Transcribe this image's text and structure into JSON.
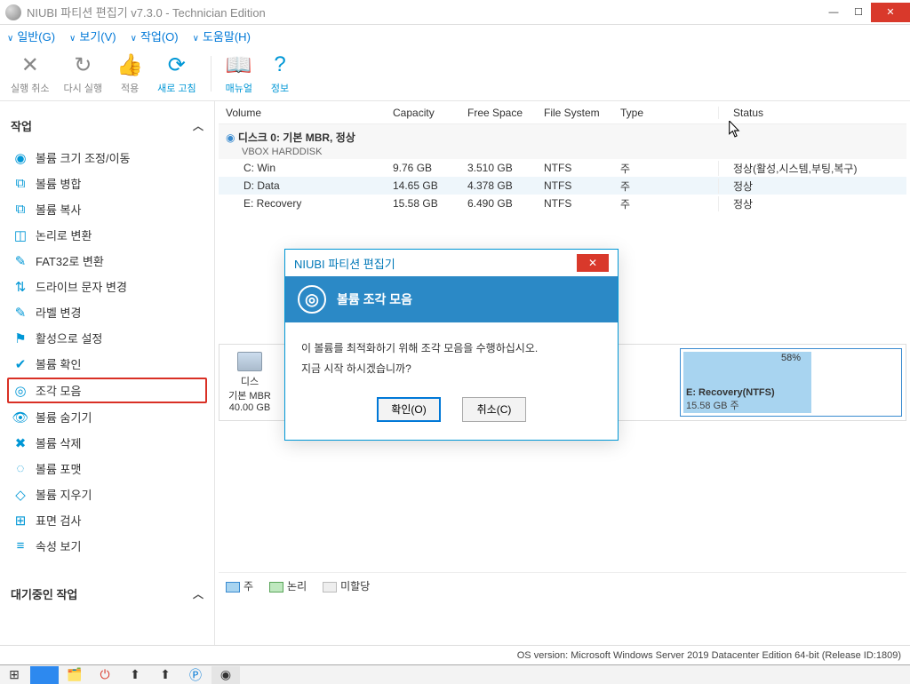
{
  "title": "NIUBI 파티션 편집기 v7.3.0 - Technician Edition",
  "menu": {
    "general": "일반(G)",
    "view": "보기(V)",
    "task": "작업(O)",
    "help": "도움말(H)"
  },
  "toolbar": {
    "undo": "실행 취소",
    "redo": "다시 실행",
    "apply": "적용",
    "refresh": "새로 고침",
    "manual": "매뉴얼",
    "info": "정보"
  },
  "sidebar": {
    "tasks_label": "작업",
    "items": [
      {
        "icon": "◉",
        "label": "볼륨 크기 조정/이동"
      },
      {
        "icon": "⧉",
        "label": "볼륨 병합"
      },
      {
        "icon": "⧉",
        "label": "볼륨 복사"
      },
      {
        "icon": "◫",
        "label": "논리로 변환"
      },
      {
        "icon": "✎",
        "label": "FAT32로 변환"
      },
      {
        "icon": "⇅",
        "label": "드라이브 문자 변경"
      },
      {
        "icon": "✎",
        "label": "라벨 변경"
      },
      {
        "icon": "⚑",
        "label": "활성으로 설정"
      },
      {
        "icon": "✔",
        "label": "볼륨 확인"
      },
      {
        "icon": "◎",
        "label": "조각 모음"
      },
      {
        "icon": "👁",
        "label": "볼륨 숨기기"
      },
      {
        "icon": "✖",
        "label": "볼륨 삭제"
      },
      {
        "icon": "◌",
        "label": "볼륨 포맷"
      },
      {
        "icon": "◇",
        "label": "볼륨 지우기"
      },
      {
        "icon": "⊞",
        "label": "표면 검사"
      },
      {
        "icon": "≡",
        "label": "속성 보기"
      }
    ],
    "pending_label": "대기중인 작업"
  },
  "grid": {
    "headers": {
      "volume": "Volume",
      "capacity": "Capacity",
      "free": "Free Space",
      "fs": "File System",
      "type": "Type",
      "status": "Status"
    },
    "disk": {
      "name": "디스크 0: 기본 MBR, 정상",
      "sub": "VBOX HARDDISK"
    },
    "rows": [
      {
        "vol": "C: Win",
        "cap": "9.76 GB",
        "free": "3.510 GB",
        "fs": "NTFS",
        "type": "주",
        "status": "정상(활성,시스템,부팅,복구)"
      },
      {
        "vol": "D: Data",
        "cap": "14.65 GB",
        "free": "4.378 GB",
        "fs": "NTFS",
        "type": "주",
        "status": "정상"
      },
      {
        "vol": "E: Recovery",
        "cap": "15.58 GB",
        "free": "6.490 GB",
        "fs": "NTFS",
        "type": "주",
        "status": "정상"
      }
    ]
  },
  "diskmap": {
    "label": "디스",
    "model": "기본 MBR",
    "size": "40.00 GB",
    "part": {
      "pct": "58%",
      "name": "E: Recovery(NTFS)",
      "sub": "15.58 GB 주"
    }
  },
  "legend": {
    "primary": "주",
    "logical": "논리",
    "unalloc": "미할당"
  },
  "statusbar": "OS version: Microsoft Windows Server 2019 Datacenter Edition  64-bit  (Release ID:1809)",
  "modal": {
    "app_title": "NIUBI 파티션 편집기",
    "banner": "볼륨 조각 모음",
    "line1": "이 볼륨를 최적화하기 위해 조각 모음을 수행하십시오.",
    "line2": "지금 시작 하시겠습니까?",
    "ok": "확인(O)",
    "cancel": "취소(C)"
  }
}
